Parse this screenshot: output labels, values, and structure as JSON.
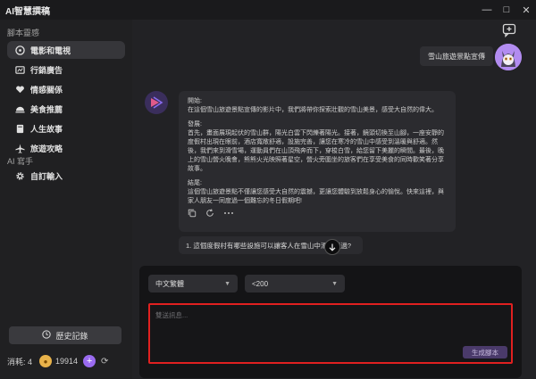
{
  "window": {
    "title": "AI智慧撰稿",
    "controls": [
      "—",
      "□",
      "✕"
    ]
  },
  "sidebar": {
    "section_script": "腳本靈感",
    "items": [
      {
        "label": "電影和電視",
        "icon": "film-icon",
        "active": true
      },
      {
        "label": "行銷廣告",
        "icon": "ad-icon",
        "active": false
      },
      {
        "label": "情感關係",
        "icon": "heart-icon",
        "active": false
      },
      {
        "label": "美食推薦",
        "icon": "food-icon",
        "active": false
      },
      {
        "label": "人生故事",
        "icon": "book-icon",
        "active": false
      },
      {
        "label": "旅遊攻略",
        "icon": "plane-icon",
        "active": false
      }
    ],
    "section_ai": "AI 寫手",
    "ai_items": [
      {
        "label": "自訂輸入",
        "icon": "gear-icon"
      }
    ],
    "history_button": "歷史記錄",
    "consume_label": "消耗: 4",
    "coins": "19914"
  },
  "chat": {
    "user_message": "雪山旅遊景點宣傳",
    "ai_reply": {
      "opening_label": "開始:",
      "opening_text": "在這個雪山旅遊景點宣傳的影片中，我們將帶你探索壯觀的雪山美景，感受大自然的偉大。",
      "body_label": "發展:",
      "body_text": "首先，畫面展現起伏的雪山群，陽光白雲下閃爍著陽光。接著，鏡頭切換至山腳，一座安靜的度假村出現在眼前，酒店寬敞舒適，設施完善，讓您在寒冷的雪山中感受到溫暖與舒適。然後，我們來到滑雪場，運動員們在山頂飛奔而下，穿梭白雪，給您留下美麗的瞬間。最後，晚上的雪山營火晚會，熊熊火光映照著星空，營火旁圍坐的旅客們在享受美食的同時歡笑著分享故事。",
      "ending_label": "結尾:",
      "ending_text": "這個雪山旅遊景點不僅讓您感受大自然的震撼，更讓您體驗到放鬆身心的愉悅。快來這裡，與家人朋友一同度過一個難忘的冬日假期吧!"
    },
    "suggestion": "1. 這個度假村有哪些設施可以讓客人在雪山中滑雪度過?"
  },
  "input": {
    "language": "中文繁體",
    "length": "<200",
    "placeholder": "雙送訊息...",
    "value": "",
    "generate_button": "生成腳本"
  },
  "colors": {
    "accent_purple": "#9a6bf0",
    "highlight_border": "#e02020",
    "coin": "#e8b24a"
  }
}
